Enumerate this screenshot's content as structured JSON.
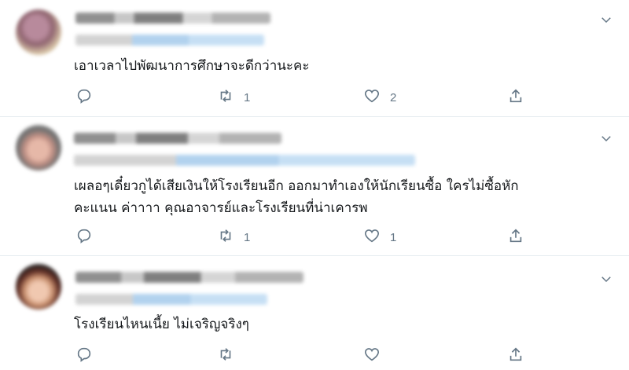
{
  "tweets": [
    {
      "text_lines": [
        "เอาเวลาไปพัฒนาการศึกษาจะดีกว่านะคะ"
      ],
      "actions": {
        "reply": "",
        "retweet": "1",
        "like": "2"
      }
    },
    {
      "text_lines": [
        "เผลอๆเดี๋ยวกูได้เสียเงินให้โรงเรียนอีก ออกมาทำเองให้นักเรียนซื้อ ใครไม่ซื้อหัก",
        "คะแนน ค่าาาา คุณอาจารย์และโรงเรียนที่น่าเคารพ"
      ],
      "actions": {
        "reply": "",
        "retweet": "1",
        "like": "1"
      }
    },
    {
      "text_lines": [
        "โรงเรียนไหนเนี้ย ไม่เจริญจริงๆ"
      ],
      "actions": {
        "reply": "",
        "retweet": "",
        "like": ""
      }
    }
  ],
  "icons": {
    "reply": "reply-icon",
    "retweet": "retweet-icon",
    "like": "heart-icon",
    "share": "share-icon",
    "more": "chevron-down-icon"
  },
  "colors": {
    "icon": "#657786",
    "divider": "#e6ecf0",
    "text": "#14171a"
  }
}
